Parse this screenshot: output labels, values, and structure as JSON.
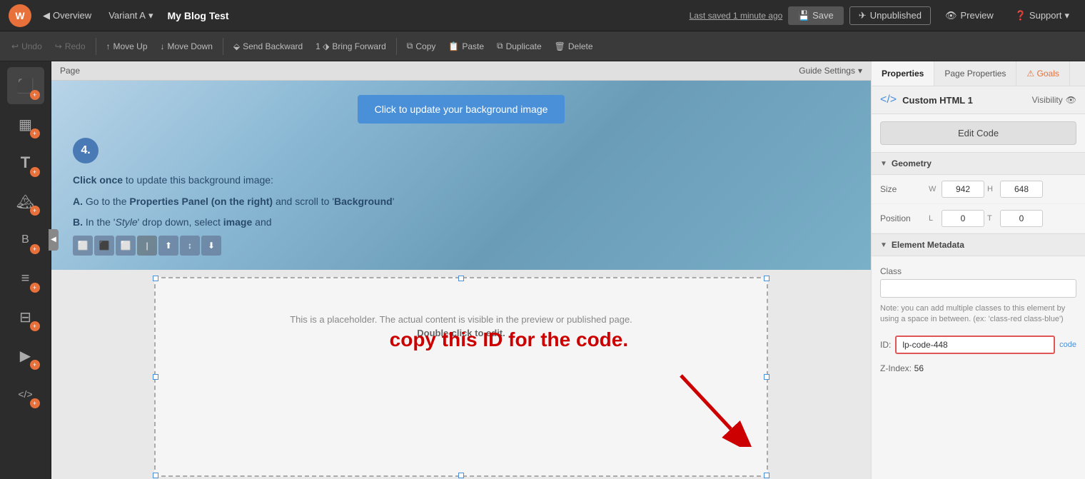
{
  "topnav": {
    "logo_text": "W",
    "overview_label": "Overview",
    "variant_label": "Variant A",
    "page_title": "My Blog Test",
    "last_saved": "Last saved  1 minute ago",
    "save_label": "Save",
    "unpublished_label": "Unpublished",
    "preview_label": "Preview",
    "support_label": "Support"
  },
  "toolbar": {
    "undo_label": "Undo",
    "redo_label": "Redo",
    "move_up_label": "Move Up",
    "move_down_label": "Move Down",
    "send_backward_label": "Send Backward",
    "bring_forward_label": "Bring Forward",
    "copy_label": "Copy",
    "paste_label": "Paste",
    "duplicate_label": "Duplicate",
    "delete_label": "Delete"
  },
  "page_tab": {
    "label": "Page",
    "guide_settings": "Guide Settings"
  },
  "sidebar": {
    "icons": [
      {
        "name": "section-icon",
        "symbol": "⬛",
        "label": ""
      },
      {
        "name": "block-icon",
        "symbol": "▦",
        "label": ""
      },
      {
        "name": "text-icon",
        "symbol": "T",
        "label": ""
      },
      {
        "name": "image-icon",
        "symbol": "🏔",
        "label": ""
      },
      {
        "name": "button-icon",
        "symbol": "B",
        "label": ""
      },
      {
        "name": "list-icon",
        "symbol": "≡",
        "label": ""
      },
      {
        "name": "rows-icon",
        "symbol": "⊟",
        "label": ""
      },
      {
        "name": "play-icon",
        "symbol": "▶",
        "label": ""
      },
      {
        "name": "code-icon",
        "symbol": "</>",
        "label": ""
      }
    ]
  },
  "canvas": {
    "banner_btn": "Click to update your background image",
    "step_number": "4.",
    "instruction_line1_pre": "Click ",
    "instruction_line1_em": "once",
    "instruction_line1_post": " to update this background image:",
    "instruction_a_pre": "A. Go to the ",
    "instruction_a_em": "Properties Panel (on the right)",
    "instruction_a_post": " and scroll to '",
    "instruction_a_bold": "Background",
    "instruction_a_end": "'",
    "instruction_b_pre": "B. In the '",
    "instruction_b_em1": "Style",
    "instruction_b_mid": "' drop down, select ",
    "instruction_b_em2": "image",
    "instruction_b_end": " and",
    "placeholder_text": "This is a placeholder. The actual content is visible in the preview or published page.",
    "dblclick_text": "Double-click to edit.",
    "red_annotation": "copy this ID for the code.",
    "id_value": "lp-code-448"
  },
  "right_panel": {
    "tab_properties": "Properties",
    "tab_page_properties": "Page Properties",
    "tab_goals": "Goals",
    "element_title": "Custom HTML 1",
    "visibility_label": "Visibility",
    "edit_code_label": "Edit Code",
    "geometry_section": "Geometry",
    "size_label": "Size",
    "size_w_label": "W",
    "size_h_label": "H",
    "size_w_value": "942",
    "size_h_value": "648",
    "position_label": "Position",
    "position_l_label": "L",
    "position_t_label": "T",
    "position_l_value": "0",
    "position_t_value": "0",
    "metadata_section": "Element Metadata",
    "class_label": "Class",
    "class_placeholder": "",
    "class_note": "Note: you can add multiple classes to this element by using a space in between. (ex: 'class-red class-blue')",
    "id_label": "ID:",
    "id_value": "lp-code-448",
    "copy_label": "ode",
    "zindex_label": "Z-Index:",
    "zindex_value": "56"
  }
}
